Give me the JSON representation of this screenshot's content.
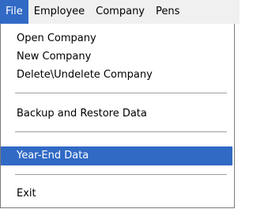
{
  "menubar": {
    "file": "File",
    "employee": "Employee",
    "company": "Company",
    "pens": "Pens"
  },
  "file_menu": {
    "open_company": "Open Company",
    "new_company": "New Company",
    "delete_undelete_company": "Delete\\Undelete Company",
    "backup_restore": "Backup and Restore Data",
    "year_end_data": "Year-End Data",
    "exit": "Exit"
  },
  "colors": {
    "highlight": "#316ac5",
    "menubar_bg": "#f0f0f0"
  }
}
